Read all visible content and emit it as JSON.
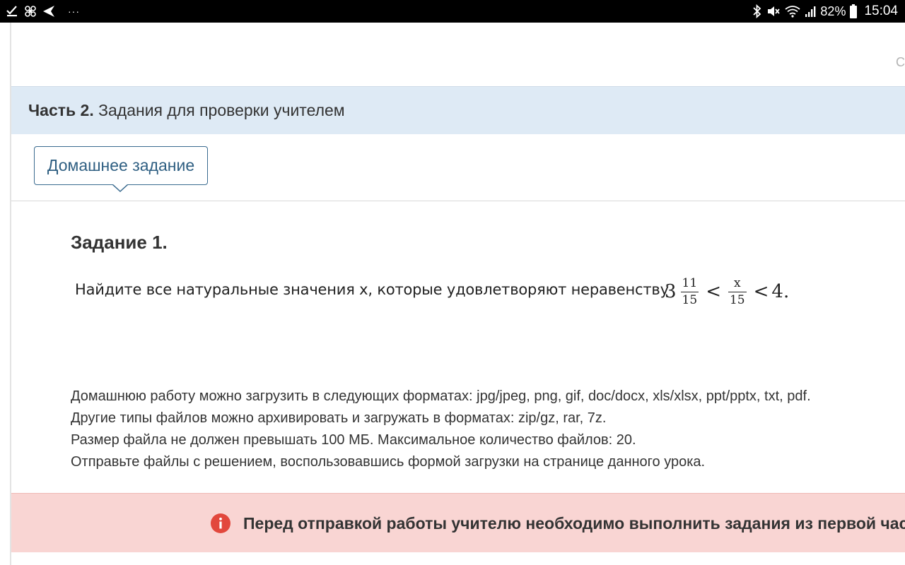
{
  "status_bar": {
    "battery": "82%",
    "time": "15:04",
    "icons": [
      "download-done-icon",
      "fan-icon",
      "send-icon",
      "more-dots-icon",
      "bluetooth-icon",
      "mute-icon",
      "wifi-icon",
      "signal-icon",
      "battery-icon"
    ],
    "dots": "···"
  },
  "topbar": {
    "cut_text": "Со"
  },
  "section": {
    "title_bold": "Часть 2.",
    "title_rest": " Задания для проверки учителем",
    "band_color": "#deeaf5"
  },
  "tabs": [
    {
      "label": "Домашнее задание",
      "active": true
    }
  ],
  "task": {
    "title": "Задание 1.",
    "statement": "Найдите все натуральные значения x, которые удовлетворяют неравенству",
    "math": {
      "whole": "3",
      "frac1_num": "11",
      "frac1_den": "15",
      "lt1": "<",
      "frac2_num": "x",
      "frac2_den": "15",
      "lt2": "<",
      "right": "4."
    }
  },
  "info_lines": [
    "Домашнюю работу можно загрузить в следующих форматах: jpg/jpeg, png, gif, doc/docx, xls/xlsx, ppt/pptx, txt, pdf.",
    "Другие типы файлов можно архивировать и загружать в форматах: zip/gz, rar, 7z.",
    "Размер файла не должен превышать 100 МБ. Максимальное количество файлов: 20.",
    "Отправьте файлы с решением, воспользовавшись формой загрузки на странице данного урока."
  ],
  "alert": {
    "message": "Перед отправкой работы учителю необходимо выполнить задания из первой части",
    "icon": "info-alert-icon",
    "background": "#f9d5d3",
    "icon_color": "#e2483d"
  }
}
